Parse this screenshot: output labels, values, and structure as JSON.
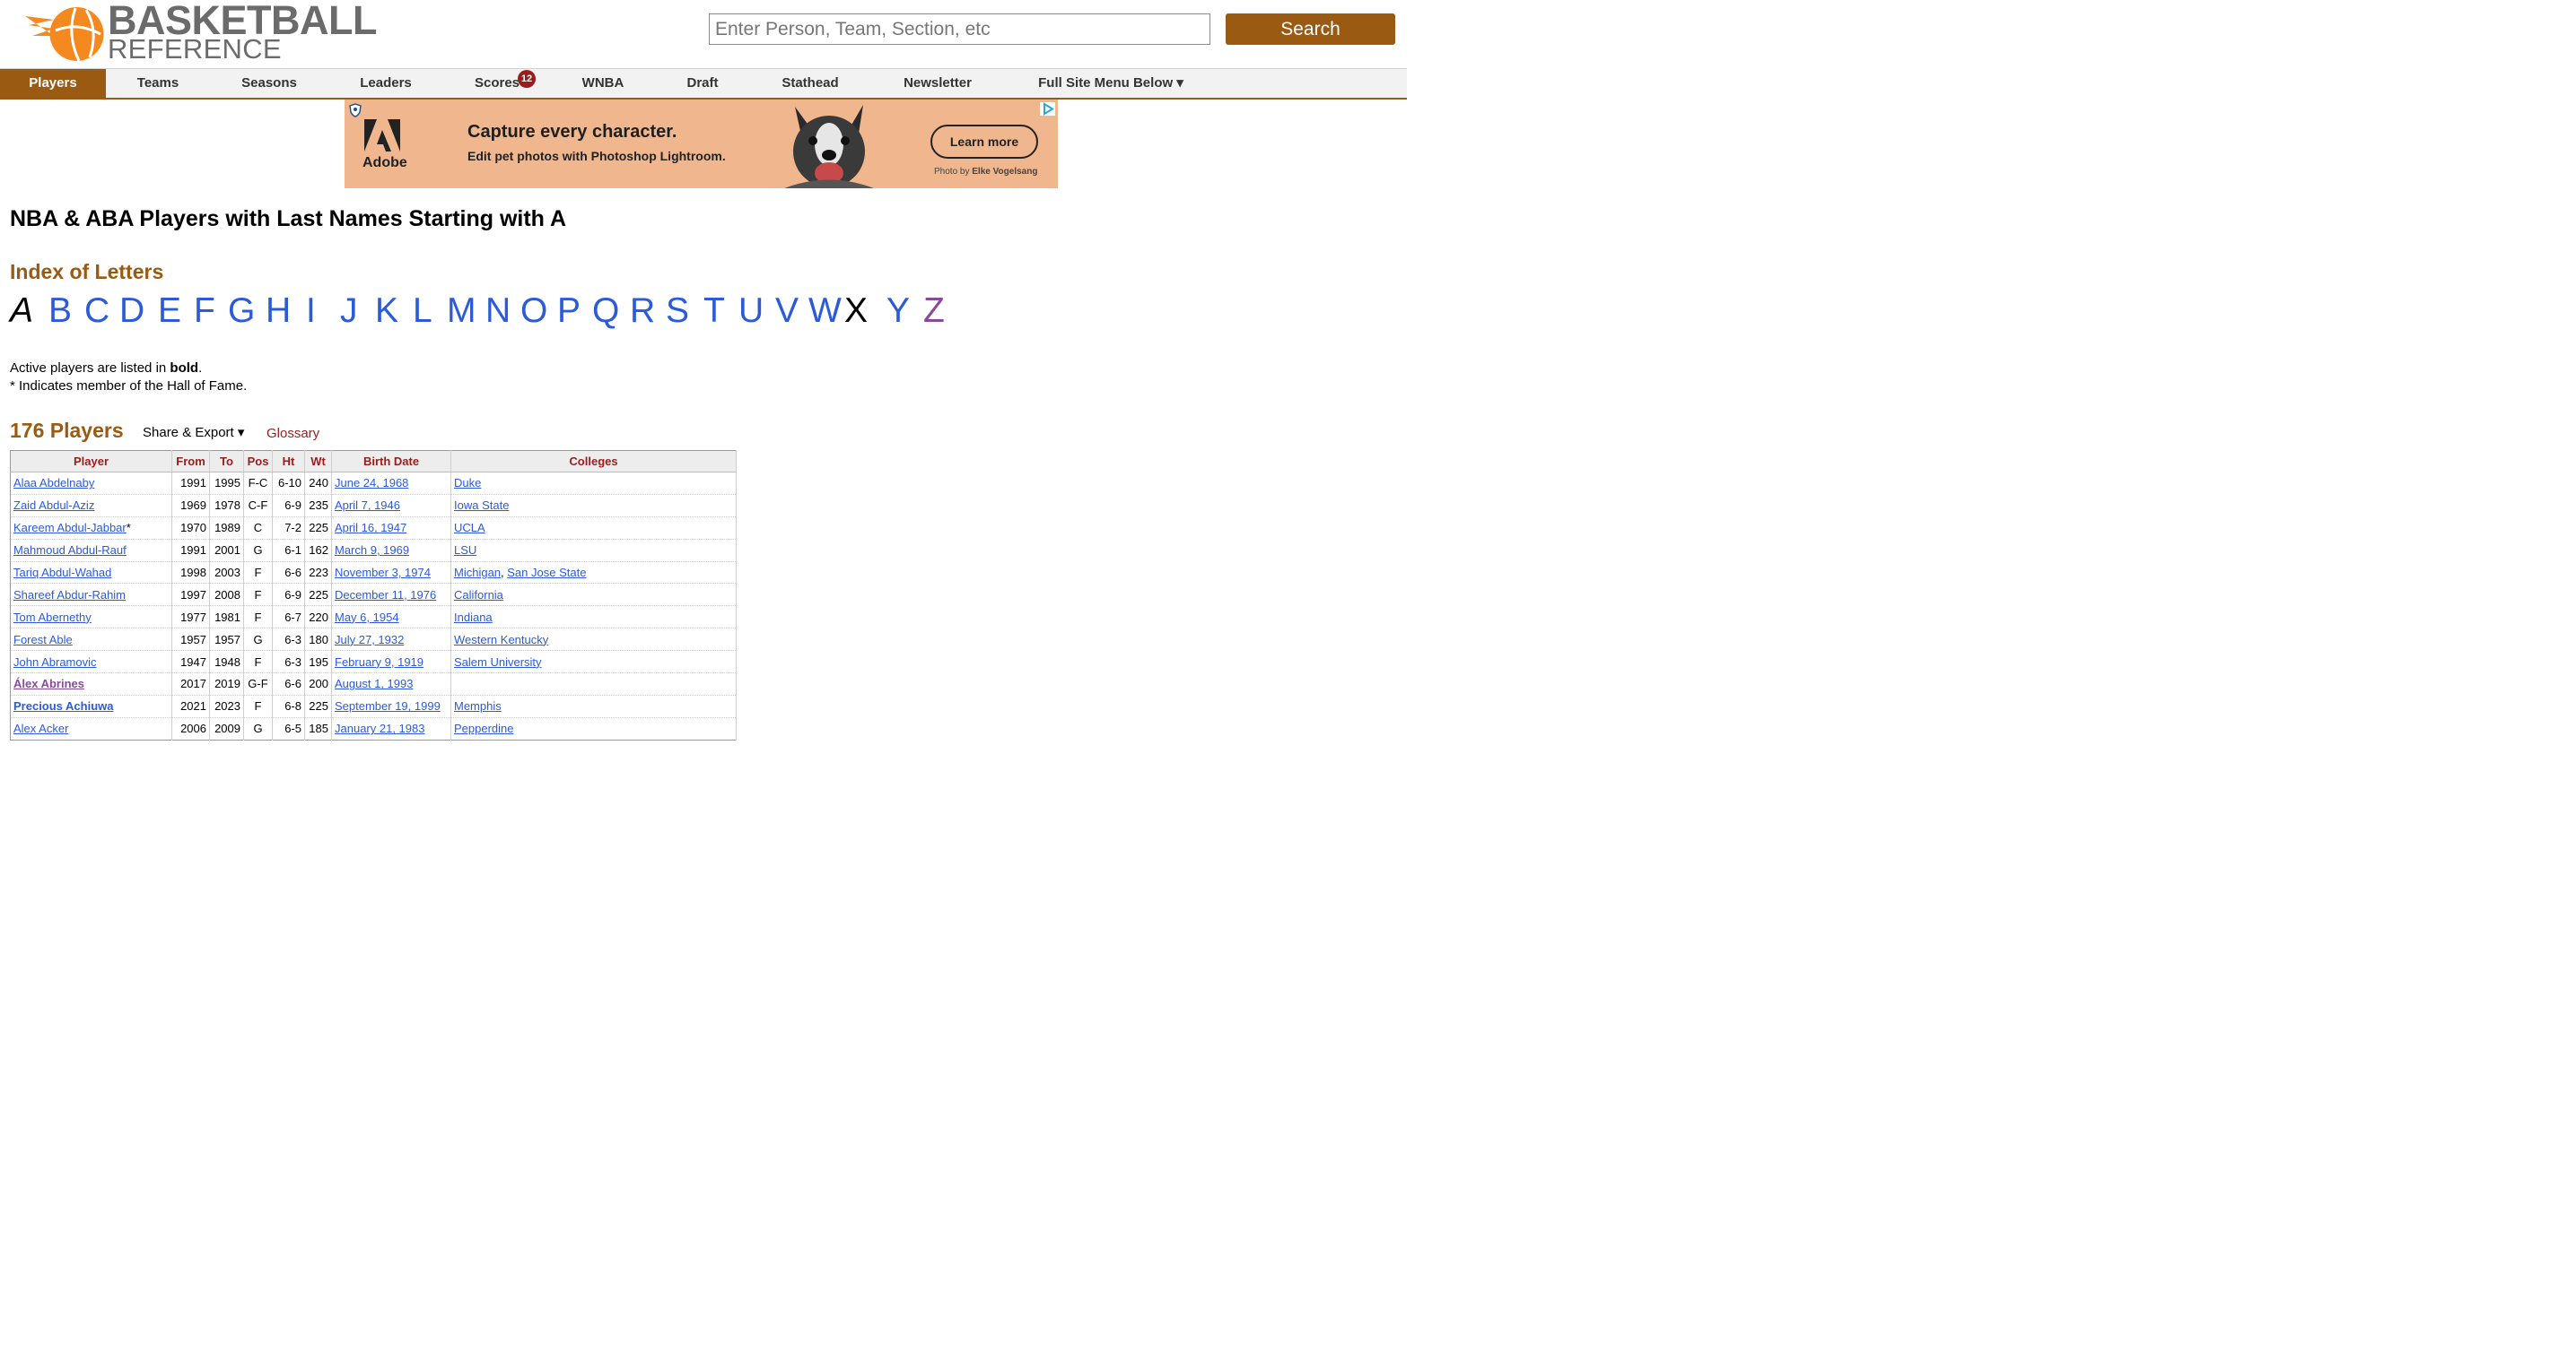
{
  "header": {
    "logo_line1": "BASKETBALL",
    "logo_line2": "REFERENCE",
    "search_placeholder": "Enter Person, Team, Section, etc",
    "search_button": "Search",
    "brand_color": "#9a5a12",
    "logo_color": "#f4891f"
  },
  "nav": {
    "items": [
      "Players",
      "Teams",
      "Seasons",
      "Leaders",
      "Scores",
      "WNBA",
      "Draft",
      "Stathead",
      "Newsletter",
      "Full Site Menu Below ▾"
    ],
    "active": "Players",
    "scores_badge": "12"
  },
  "ad": {
    "brand": "Adobe",
    "headline": "Capture every character.",
    "subline": "Edit pet photos with Photoshop Lightroom.",
    "cta": "Learn more",
    "credit_prefix": "Photo by",
    "credit_name": "Elke Vogelsang"
  },
  "page": {
    "title": "NBA & ABA Players with Last Names Starting with A",
    "index_heading": "Index of Letters",
    "letters": [
      "A",
      "B",
      "C",
      "D",
      "E",
      "F",
      "G",
      "H",
      "I",
      "J",
      "K",
      "L",
      "M",
      "N",
      "O",
      "P",
      "Q",
      "R",
      "S",
      "T",
      "U",
      "V",
      "W",
      "X",
      "Y",
      "Z"
    ],
    "current_letter": "A",
    "note_active_prefix": "Active players are listed in ",
    "note_active_bold": "bold",
    "note_active_suffix": ".",
    "note_hof": "* Indicates member of the Hall of Fame.",
    "count_heading": "176 Players",
    "share_export": "Share & Export ▾",
    "glossary": "Glossary"
  },
  "table": {
    "headers": [
      "Player",
      "From",
      "To",
      "Pos",
      "Ht",
      "Wt",
      "Birth Date",
      "Colleges"
    ],
    "rows": [
      {
        "player": "Alaa Abdelnaby",
        "hof": "",
        "active": false,
        "visited": false,
        "from": "1991",
        "to": "1995",
        "pos": "F-C",
        "ht": "6-10",
        "wt": "240",
        "birth": "June 24, 1968",
        "colleges": [
          "Duke"
        ]
      },
      {
        "player": "Zaid Abdul-Aziz",
        "hof": "",
        "active": false,
        "visited": false,
        "from": "1969",
        "to": "1978",
        "pos": "C-F",
        "ht": "6-9",
        "wt": "235",
        "birth": "April 7, 1946",
        "colleges": [
          "Iowa State"
        ]
      },
      {
        "player": "Kareem Abdul-Jabbar",
        "hof": "*",
        "active": false,
        "visited": false,
        "from": "1970",
        "to": "1989",
        "pos": "C",
        "ht": "7-2",
        "wt": "225",
        "birth": "April 16, 1947",
        "colleges": [
          "UCLA"
        ]
      },
      {
        "player": "Mahmoud Abdul-Rauf",
        "hof": "",
        "active": false,
        "visited": false,
        "from": "1991",
        "to": "2001",
        "pos": "G",
        "ht": "6-1",
        "wt": "162",
        "birth": "March 9, 1969",
        "colleges": [
          "LSU"
        ]
      },
      {
        "player": "Tariq Abdul-Wahad",
        "hof": "",
        "active": false,
        "visited": false,
        "from": "1998",
        "to": "2003",
        "pos": "F",
        "ht": "6-6",
        "wt": "223",
        "birth": "November 3, 1974",
        "colleges": [
          "Michigan",
          "San Jose State"
        ]
      },
      {
        "player": "Shareef Abdur-Rahim",
        "hof": "",
        "active": false,
        "visited": false,
        "from": "1997",
        "to": "2008",
        "pos": "F",
        "ht": "6-9",
        "wt": "225",
        "birth": "December 11, 1976",
        "colleges": [
          "California"
        ]
      },
      {
        "player": "Tom Abernethy",
        "hof": "",
        "active": false,
        "visited": false,
        "from": "1977",
        "to": "1981",
        "pos": "F",
        "ht": "6-7",
        "wt": "220",
        "birth": "May 6, 1954",
        "colleges": [
          "Indiana"
        ]
      },
      {
        "player": "Forest Able",
        "hof": "",
        "active": false,
        "visited": false,
        "from": "1957",
        "to": "1957",
        "pos": "G",
        "ht": "6-3",
        "wt": "180",
        "birth": "July 27, 1932",
        "colleges": [
          "Western Kentucky"
        ]
      },
      {
        "player": "John Abramovic",
        "hof": "",
        "active": false,
        "visited": false,
        "from": "1947",
        "to": "1948",
        "pos": "F",
        "ht": "6-3",
        "wt": "195",
        "birth": "February 9, 1919",
        "colleges": [
          "Salem University"
        ]
      },
      {
        "player": "Álex Abrines",
        "hof": "",
        "active": false,
        "visited": true,
        "from": "2017",
        "to": "2019",
        "pos": "G-F",
        "ht": "6-6",
        "wt": "200",
        "birth": "August 1, 1993",
        "colleges": []
      },
      {
        "player": "Precious Achiuwa",
        "hof": "",
        "active": true,
        "visited": false,
        "from": "2021",
        "to": "2023",
        "pos": "F",
        "ht": "6-8",
        "wt": "225",
        "birth": "September 19, 1999",
        "colleges": [
          "Memphis"
        ]
      },
      {
        "player": "Alex Acker",
        "hof": "",
        "active": false,
        "visited": false,
        "from": "2006",
        "to": "2009",
        "pos": "G",
        "ht": "6-5",
        "wt": "185",
        "birth": "January 21, 1983",
        "colleges": [
          "Pepperdine"
        ]
      }
    ]
  }
}
